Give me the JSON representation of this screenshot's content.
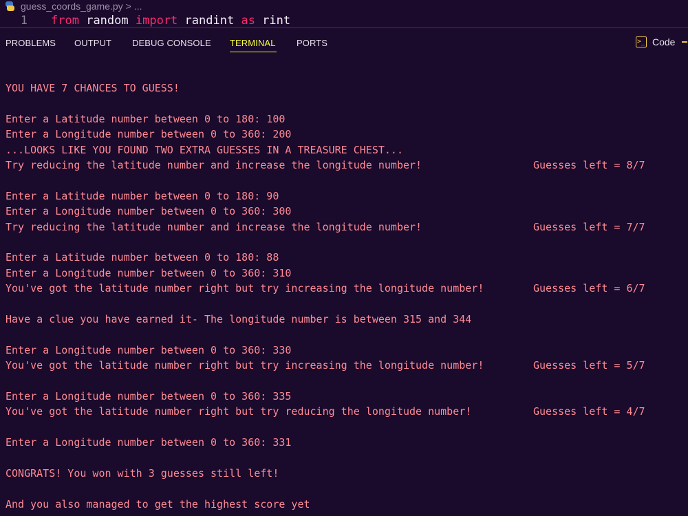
{
  "editor": {
    "filename": "guess_coords_game.py",
    "breadcrumb_rest": "...",
    "line_number": "1",
    "code": {
      "kw_from": "from",
      "mod": "random",
      "kw_import": "import",
      "func": "randint",
      "kw_as": "as",
      "alias": "rint"
    },
    "accent_color": "#ff2a6d"
  },
  "panel": {
    "tabs": [
      "PROBLEMS",
      "OUTPUT",
      "DEBUG CONSOLE",
      "TERMINAL",
      "PORTS"
    ],
    "active_tab": "TERMINAL",
    "code_button_label": "Code",
    "active_color": "#f6ff3a"
  },
  "terminal": {
    "text_color": "#ff8a95",
    "lines": [
      {
        "text": "YOU HAVE 7 CHANCES TO GUESS!"
      },
      {
        "text": ""
      },
      {
        "text": "Enter a Latitude number between 0 to 180: 100"
      },
      {
        "text": "Enter a Longitude number between 0 to 360: 200"
      },
      {
        "text": "...LOOKS LIKE YOU FOUND TWO EXTRA GUESSES IN A TREASURE CHEST..."
      },
      {
        "text": "Try reducing the latitude number and increase the longitude number!",
        "guesses": "Guesses left = 8/7"
      },
      {
        "text": ""
      },
      {
        "text": "Enter a Latitude number between 0 to 180: 90"
      },
      {
        "text": "Enter a Longitude number between 0 to 360: 300"
      },
      {
        "text": "Try reducing the latitude number and increase the longitude number!",
        "guesses": "Guesses left = 7/7"
      },
      {
        "text": ""
      },
      {
        "text": "Enter a Latitude number between 0 to 180: 88"
      },
      {
        "text": "Enter a Longitude number between 0 to 360: 310"
      },
      {
        "text": "You've got the latitude number right but try increasing the longitude number!",
        "guesses": "Guesses left = 6/7"
      },
      {
        "text": ""
      },
      {
        "text": "Have a clue you have earned it- The longitude number is between 315 and 344"
      },
      {
        "text": ""
      },
      {
        "text": "Enter a Longitude number between 0 to 360: 330"
      },
      {
        "text": "You've got the latitude number right but try increasing the longitude number!",
        "guesses": "Guesses left = 5/7"
      },
      {
        "text": ""
      },
      {
        "text": "Enter a Longitude number between 0 to 360: 335"
      },
      {
        "text": "You've got the latitude number right but try reducing the longitude number!",
        "guesses": "Guesses left = 4/7"
      },
      {
        "text": ""
      },
      {
        "text": "Enter a Longitude number between 0 to 360: 331"
      },
      {
        "text": ""
      },
      {
        "text": "CONGRATS! You won with 3 guesses still left!"
      },
      {
        "text": ""
      },
      {
        "text": "And you also managed to get the highest score yet"
      }
    ]
  }
}
